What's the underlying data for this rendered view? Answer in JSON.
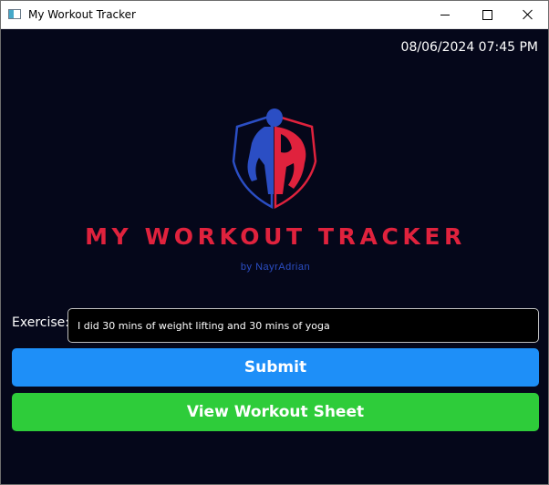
{
  "window": {
    "title": "My Workout Tracker",
    "controls": [
      "minimize-icon",
      "maximize-icon",
      "close-icon"
    ]
  },
  "header": {
    "datetime": "08/06/2024 07:45 PM"
  },
  "logo": {
    "title": "MY WORKOUT TRACKER",
    "subtitle": "by NayrAdrian"
  },
  "form": {
    "exercise_label": "Exercise:",
    "exercise_value": "I did 30 mins of weight lifting and 30 mins of yoga"
  },
  "buttons": {
    "submit_label": "Submit",
    "view_sheet_label": "View Workout Sheet"
  },
  "colors": {
    "background": "#05071a",
    "brand_red": "#e0223d",
    "brand_blue": "#2b4ec4",
    "submit": "#1e8ff8",
    "view_sheet": "#2ecc3a"
  }
}
